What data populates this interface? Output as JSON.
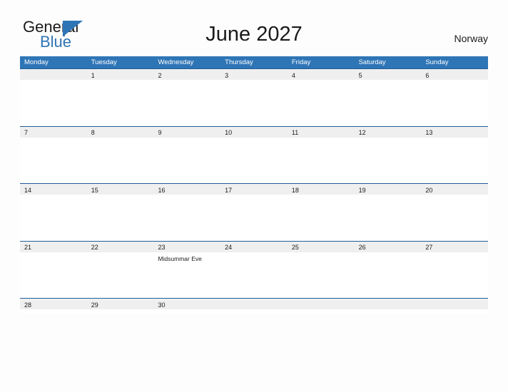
{
  "brand": {
    "line1": "General",
    "line2": "Blue",
    "flag_icon": "blue-pennant-triangle",
    "accent_color": "#2e75b6"
  },
  "header": {
    "title": "June 2027",
    "country": "Norway"
  },
  "colors": {
    "header_blue": "#2e75b6",
    "row_border_blue": "#1f5c99",
    "date_band_gray": "#efefef",
    "page_background": "#fdfdfd",
    "text": "#1a1a1a"
  },
  "calendar": {
    "month": "June",
    "year": "2027",
    "weekday_headers": [
      "Monday",
      "Tuesday",
      "Wednesday",
      "Thursday",
      "Friday",
      "Saturday",
      "Sunday"
    ],
    "weeks": [
      [
        {
          "day": "",
          "events": []
        },
        {
          "day": "1",
          "events": []
        },
        {
          "day": "2",
          "events": []
        },
        {
          "day": "3",
          "events": []
        },
        {
          "day": "4",
          "events": []
        },
        {
          "day": "5",
          "events": []
        },
        {
          "day": "6",
          "events": []
        }
      ],
      [
        {
          "day": "7",
          "events": []
        },
        {
          "day": "8",
          "events": []
        },
        {
          "day": "9",
          "events": []
        },
        {
          "day": "10",
          "events": []
        },
        {
          "day": "11",
          "events": []
        },
        {
          "day": "12",
          "events": []
        },
        {
          "day": "13",
          "events": []
        }
      ],
      [
        {
          "day": "14",
          "events": []
        },
        {
          "day": "15",
          "events": []
        },
        {
          "day": "16",
          "events": []
        },
        {
          "day": "17",
          "events": []
        },
        {
          "day": "18",
          "events": []
        },
        {
          "day": "19",
          "events": []
        },
        {
          "day": "20",
          "events": []
        }
      ],
      [
        {
          "day": "21",
          "events": []
        },
        {
          "day": "22",
          "events": []
        },
        {
          "day": "23",
          "events": [
            "Midsummar Eve"
          ]
        },
        {
          "day": "24",
          "events": []
        },
        {
          "day": "25",
          "events": []
        },
        {
          "day": "26",
          "events": []
        },
        {
          "day": "27",
          "events": []
        }
      ],
      [
        {
          "day": "28",
          "events": []
        },
        {
          "day": "29",
          "events": []
        },
        {
          "day": "30",
          "events": []
        },
        {
          "day": "",
          "events": []
        },
        {
          "day": "",
          "events": []
        },
        {
          "day": "",
          "events": []
        },
        {
          "day": "",
          "events": []
        }
      ]
    ]
  }
}
